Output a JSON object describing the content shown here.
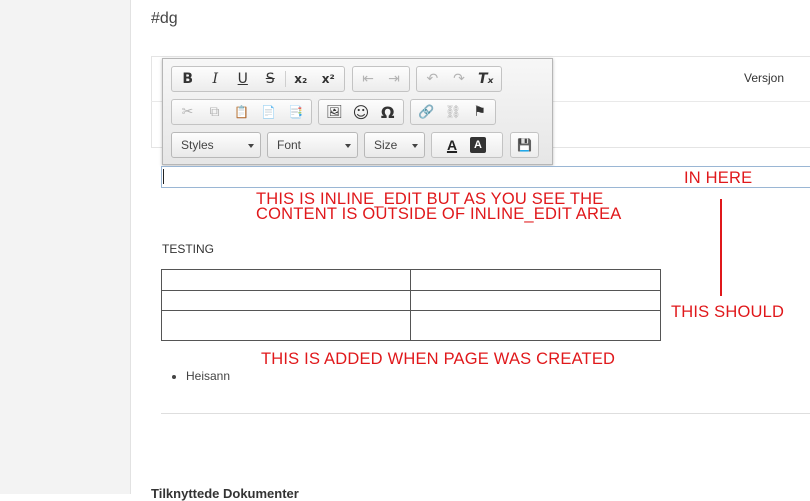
{
  "page": {
    "heading": "#dg",
    "column_header": "Versjon",
    "footer_heading": "Tilknyttede Dokumenter"
  },
  "toolbar": {
    "row1": [
      {
        "glyph": "B",
        "name": "bold"
      },
      {
        "glyph": "I",
        "name": "italic"
      },
      {
        "glyph": "U",
        "name": "underline"
      },
      {
        "glyph": "S",
        "name": "strikethrough"
      },
      {
        "glyph": "x₂",
        "name": "subscript"
      },
      {
        "glyph": "x²",
        "name": "superscript"
      },
      {
        "glyph": "⇤",
        "name": "outdent"
      },
      {
        "glyph": "⇥",
        "name": "indent"
      },
      {
        "glyph": "↶",
        "name": "undo"
      },
      {
        "glyph": "↷",
        "name": "redo"
      },
      {
        "glyph": "Tₓ",
        "name": "remove-format"
      }
    ],
    "row2": [
      {
        "glyph": "✂",
        "name": "cut"
      },
      {
        "glyph": "⧉",
        "name": "copy"
      },
      {
        "glyph": "📋",
        "name": "paste"
      },
      {
        "glyph": "📄",
        "name": "paste-text"
      },
      {
        "glyph": "📑",
        "name": "paste-word"
      },
      {
        "glyph": "🖼",
        "name": "image"
      },
      {
        "glyph": "☺",
        "name": "smiley"
      },
      {
        "glyph": "Ω",
        "name": "special-char"
      },
      {
        "glyph": "🔗",
        "name": "link"
      },
      {
        "glyph": "⛓",
        "name": "unlink"
      },
      {
        "glyph": "⚑",
        "name": "anchor"
      }
    ],
    "styles_label": "Styles",
    "font_label": "Font",
    "size_label": "Size",
    "text_color_glyph": "A",
    "bg_color_glyph": "A",
    "save_glyph": "💾"
  },
  "editor": {
    "testing_text": "TESTING",
    "table_rows": [
      [
        "",
        ""
      ],
      [
        "",
        ""
      ],
      [
        "",
        ""
      ]
    ],
    "list_items": [
      "Heisann"
    ]
  },
  "annotations": {
    "in_here": "IN HERE",
    "inline_line1": "THIS IS INLINE_EDIT BUT AS YOU SEE THE",
    "inline_line2": "CONTENT IS OUTSIDE OF INLINE_EDIT AREA",
    "this_should": "THIS SHOULD",
    "added_when_created": "THIS IS ADDED WHEN PAGE WAS CREATED",
    "color": "#e0181b"
  }
}
